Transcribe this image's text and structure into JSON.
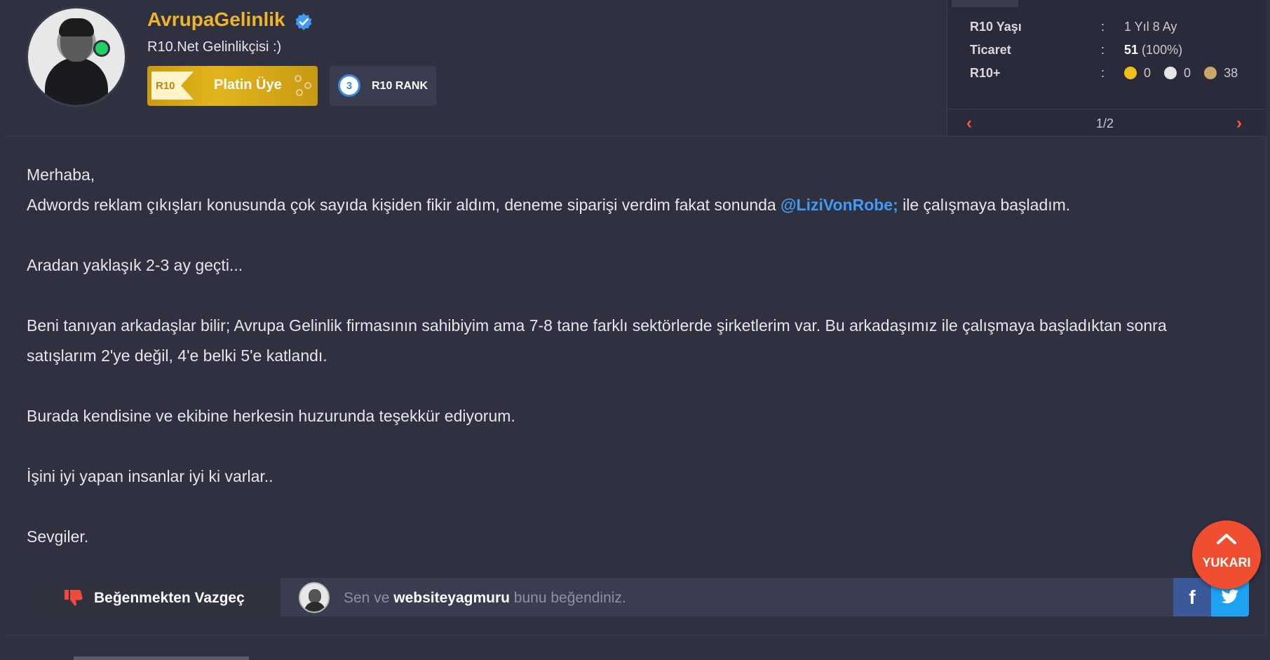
{
  "user": {
    "name": "AvrupaGelinlik",
    "title": "R10.Net Gelinlikçisi :)",
    "badges": {
      "platin_tag": "R10",
      "platin_label": "Platin Üye",
      "rank_number": "3",
      "rank_label": "R10 RANK"
    }
  },
  "stats": {
    "rows": [
      {
        "key": "R10 Yaşı",
        "sep": ":",
        "value": "1 Yıl 8 Ay"
      },
      {
        "key": "Ticaret",
        "sep": ":",
        "value_bold": "51",
        "value": "(100%)"
      },
      {
        "key": "R10+",
        "sep": ":",
        "gold": "0",
        "silver": "0",
        "bronze": "38"
      }
    ],
    "pager": "1/2",
    "colors": {
      "gold": "#f2c01a",
      "silver": "#e6e6e6",
      "bronze": "#c9a869",
      "arrow": "#ff5a36"
    }
  },
  "post": {
    "line1": "Merhaba,",
    "line2_before": "Adwords reklam çıkışları konusunda çok sayıda kişiden fikir aldım, deneme siparişi verdim fakat sonunda ",
    "line2_mention": "@LiziVonRobe;",
    "line2_after": " ile çalışmaya başladım.",
    "line3": "Aradan yaklaşık 2-3 ay geçti...",
    "line4": "Beni tanıyan arkadaşlar bilir; Avrupa Gelinlik firmasının sahibiyim ama 7-8 tane farklı sektörlerde şirketlerim var. Bu arkadaşımız ile çalışmaya başladıktan sonra satışlarım 2'ye değil, 4'e belki 5'e katlandı.",
    "line5": "Burada kendisine ve ekibine herkesin huzurunda teşekkür ediyorum.",
    "line6": "İşini iyi yapan insanlar iyi ki varlar..",
    "line7": "Sevgiler."
  },
  "actions": {
    "unlike_label": "Beğenmekten Vazgeç",
    "likes_prefix": "Sen ve",
    "likes_user": "websiteyagmuru",
    "likes_suffix": "bunu beğendiniz.",
    "share_fb": "f"
  },
  "scroll_top": {
    "label": "YUKARI"
  }
}
